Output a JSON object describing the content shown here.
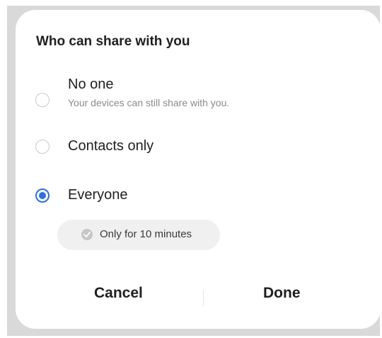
{
  "dialog": {
    "title": "Who can share with you",
    "options": [
      {
        "label": "No one",
        "sublabel": "Your devices can still share with you.",
        "selected": false
      },
      {
        "label": "Contacts only",
        "sublabel": "",
        "selected": false
      },
      {
        "label": "Everyone",
        "sublabel": "",
        "selected": true
      }
    ],
    "timer_chip": {
      "label": "Only for 10 minutes",
      "icon": "check-circle-icon"
    },
    "buttons": {
      "cancel": "Cancel",
      "done": "Done"
    }
  },
  "colors": {
    "accent": "#2f6fe0",
    "dialog_background": "#ffffff",
    "backdrop": "#d9d9d9",
    "chip_background": "#f0f0f0"
  }
}
